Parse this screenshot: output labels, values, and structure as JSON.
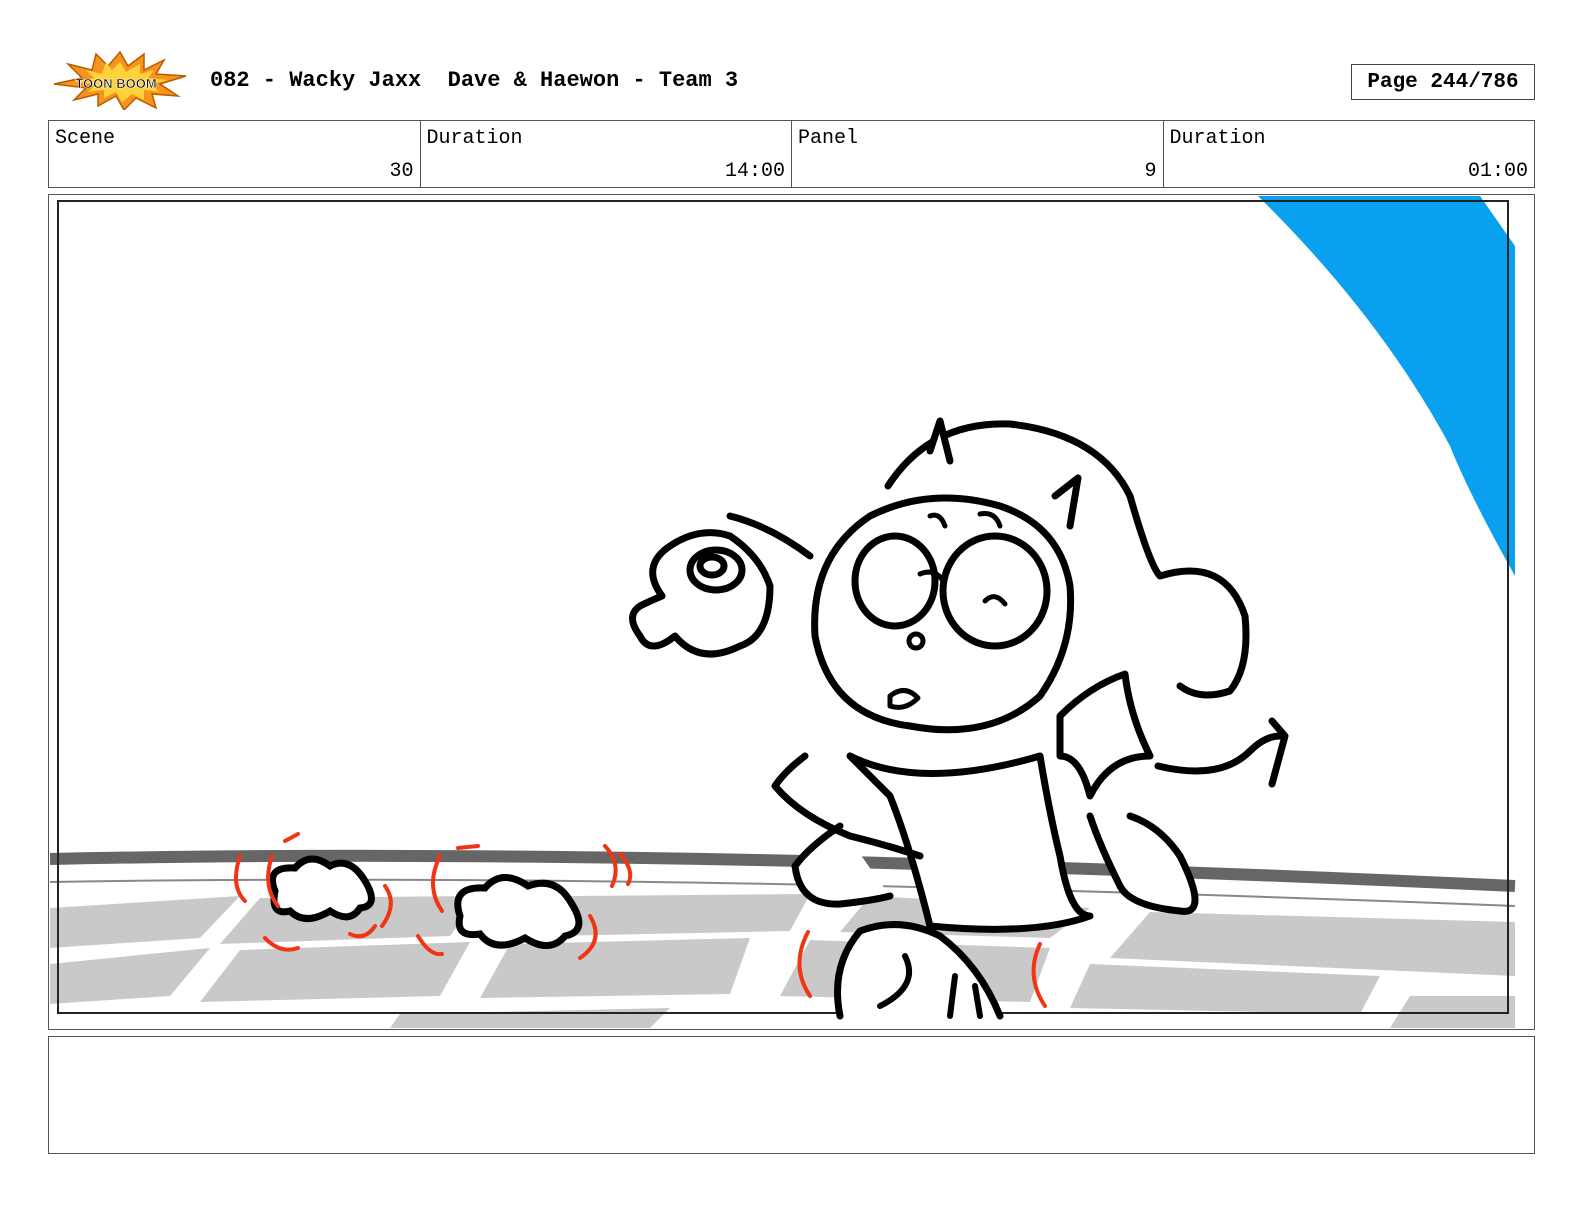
{
  "header": {
    "logo_text": "TOON BOOM",
    "title": "082 - Wacky Jaxx  Dave & Haewon - Team 3",
    "page": "Page 244/786"
  },
  "info": {
    "scene_label": "Scene",
    "scene_value": "30",
    "scene_duration_label": "Duration",
    "scene_duration_value": "14:00",
    "panel_label": "Panel",
    "panel_value": "9",
    "panel_duration_label": "Duration",
    "panel_duration_value": "01:00"
  },
  "colors": {
    "accent_blue": "#09a0f0",
    "sketch_red": "#f03414",
    "floor_gray": "#c9c9c9",
    "horizon_gray": "#666666"
  },
  "notes": {
    "text": ""
  }
}
